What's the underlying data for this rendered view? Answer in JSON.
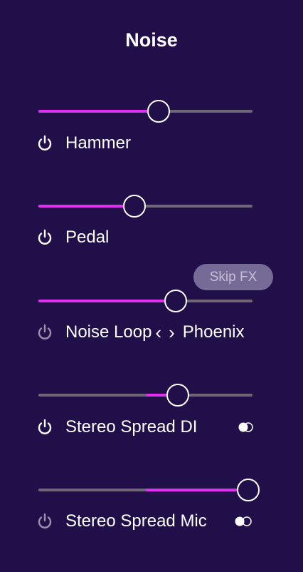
{
  "title": "Noise",
  "skip_fx": "Skip FX",
  "controls": [
    {
      "label": "Hammer",
      "value_pct": 56,
      "mode": "left",
      "enabled": true
    },
    {
      "label": "Pedal",
      "value_pct": 45,
      "mode": "left",
      "enabled": true
    },
    {
      "label": "Noise Loop",
      "value_pct": 64,
      "mode": "left",
      "enabled": false,
      "preset": "Phoenix",
      "prev_icon": "chevron-left-icon",
      "next_icon": "chevron-right-icon"
    },
    {
      "label": "Stereo Spread DI",
      "value_pct": 65,
      "mode": "center",
      "enabled": true,
      "toggle": "on"
    },
    {
      "label": "Stereo Spread Mic",
      "value_pct": 98,
      "mode": "center",
      "enabled": false,
      "toggle": "off"
    }
  ],
  "colors": {
    "background": "#210f4a",
    "accent": "#e030f0",
    "track": "#6e6777"
  }
}
